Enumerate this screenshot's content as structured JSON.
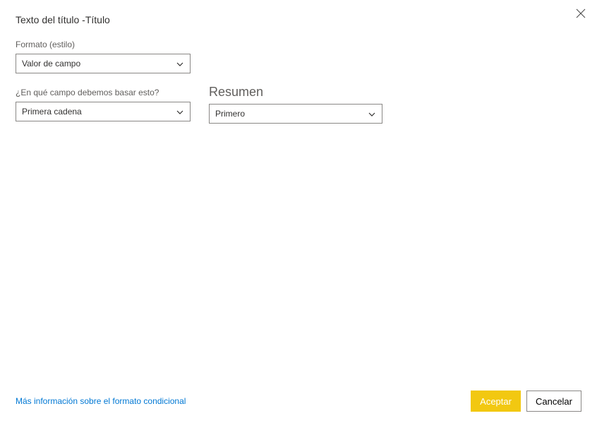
{
  "dialog": {
    "title": "Texto del título -Título",
    "close_name": "close"
  },
  "format": {
    "label": "Formato (estilo)",
    "selected": "Valor de campo"
  },
  "field": {
    "label": "¿En qué campo debemos basar esto?",
    "selected": "Primera cadena"
  },
  "summary": {
    "title": "Resumen",
    "selected": "Primero"
  },
  "footer": {
    "link": "Más información sobre el formato condicional",
    "accept": "Aceptar",
    "cancel": "Cancelar"
  }
}
